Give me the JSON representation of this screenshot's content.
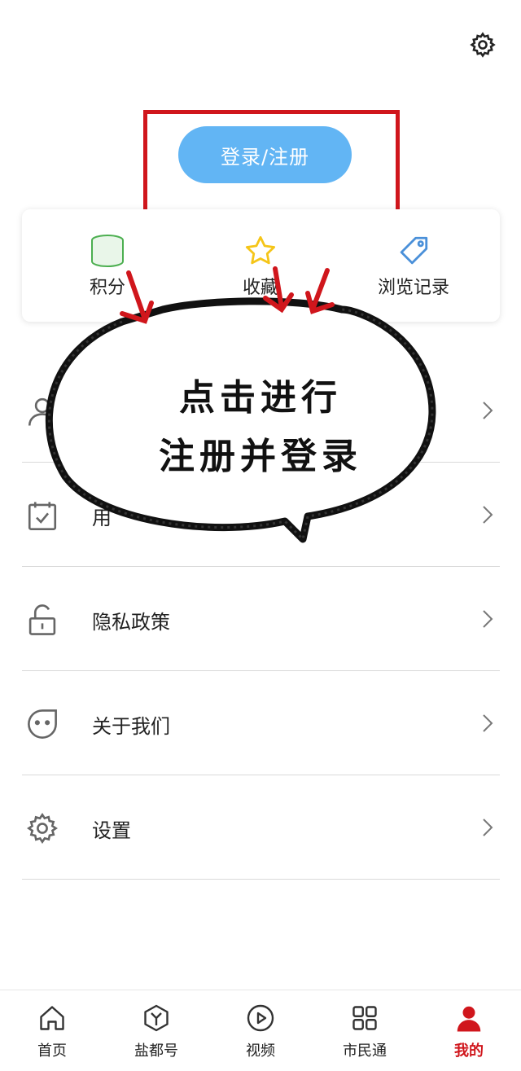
{
  "header": {
    "settings_icon": "gear-icon"
  },
  "login": {
    "label": "登录/注册",
    "color": "#62b5f4",
    "highlight_color": "#d0161c"
  },
  "quick_actions": [
    {
      "label": "积分",
      "icon": "coins-icon",
      "color": "#4caf50"
    },
    {
      "label": "收藏",
      "icon": "star-icon",
      "color": "#f5c518"
    },
    {
      "label": "浏览记录",
      "icon": "tag-icon",
      "color": "#4a90d9"
    }
  ],
  "menu": [
    {
      "label": "",
      "icon": "user-icon"
    },
    {
      "label": "用",
      "icon": "calendar-check-icon"
    },
    {
      "label": "隐私政策",
      "icon": "unlock-icon"
    },
    {
      "label": "关于我们",
      "icon": "face-icon"
    },
    {
      "label": "设置",
      "icon": "gear-icon"
    }
  ],
  "annotation": {
    "line1": "点击进行",
    "line2": "注册并登录"
  },
  "bottom_nav": [
    {
      "label": "首页",
      "icon": "home-icon"
    },
    {
      "label": "盐都号",
      "icon": "cube-icon"
    },
    {
      "label": "视频",
      "icon": "play-icon"
    },
    {
      "label": "市民通",
      "icon": "grid-icon"
    },
    {
      "label": "我的",
      "icon": "person-icon",
      "active": true
    }
  ]
}
